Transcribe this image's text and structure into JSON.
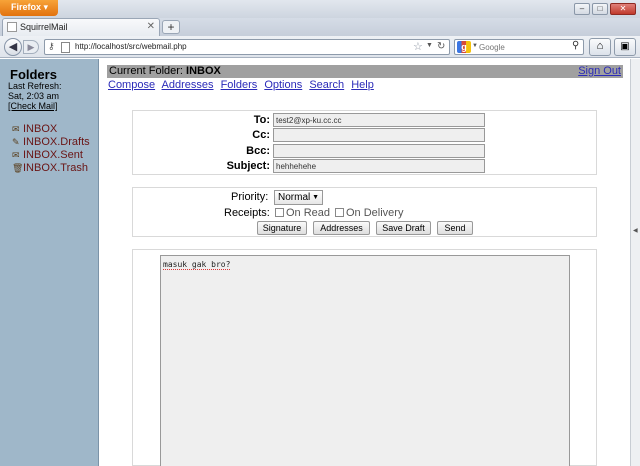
{
  "browser": {
    "firefox_label": "Firefox",
    "tab_title": "SquirrelMail",
    "new_tab_symbol": "+",
    "url": "http://localhost/src/webmail.php",
    "search_placeholder": "Google"
  },
  "sidebar": {
    "title": "Folders",
    "last_refresh_label": "Last Refresh:",
    "last_refresh_time": "Sat, 2:03 am",
    "check_mail": "[Check Mail]",
    "folders": [
      "INBOX",
      "INBOX.Drafts",
      "INBOX.Sent",
      "INBOX.Trash"
    ]
  },
  "main": {
    "current_folder_label": "Current Folder:",
    "current_folder": "INBOX",
    "sign_out": "Sign Out",
    "menu": [
      "Compose",
      "Addresses",
      "Folders",
      "Options",
      "Search",
      "Help"
    ]
  },
  "compose": {
    "to_label": "To:",
    "to_value": "test2@xp-ku.cc.cc",
    "cc_label": "Cc:",
    "cc_value": "",
    "bcc_label": "Bcc:",
    "bcc_value": "",
    "subject_label": "Subject:",
    "subject_value": "hehhehehe",
    "priority_label": "Priority:",
    "priority_value": "Normal",
    "receipts_label": "Receipts:",
    "on_read": "On Read",
    "on_delivery": "On Delivery",
    "buttons": [
      "Signature",
      "Addresses",
      "Save Draft",
      "Send"
    ],
    "body": "masuk gak bro?"
  }
}
